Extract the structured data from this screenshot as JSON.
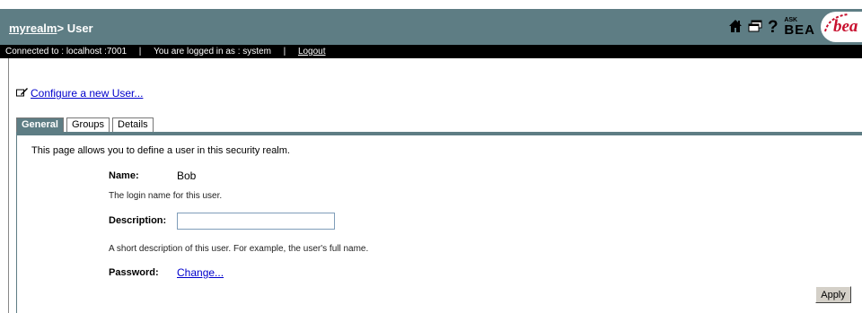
{
  "header": {
    "realm": "myrealm",
    "separator": ">",
    "page": "User",
    "ask_label": "ASK",
    "bea_label": "BEA",
    "logo_text": "bea"
  },
  "status": {
    "connected_label": "Connected to :",
    "host": "localhost :7001",
    "logged_label": "You are logged in as :",
    "user": "system",
    "logout": "Logout"
  },
  "configure_link": "Configure a new User...",
  "tabs": [
    {
      "label": "General",
      "active": true
    },
    {
      "label": "Groups",
      "active": false
    },
    {
      "label": "Details",
      "active": false
    }
  ],
  "form": {
    "intro": "This page allows you to define a user in this security realm.",
    "name_label": "Name:",
    "name_value": "Bob",
    "name_help": "The login name for this user.",
    "description_label": "Description:",
    "description_value": "",
    "description_help": "A short description of this user. For example, the user's full name.",
    "password_label": "Password:",
    "password_link": "Change...",
    "apply_label": "Apply"
  },
  "colors": {
    "header_bg": "#5e7d84",
    "status_bg": "#000000",
    "link": "#0000cc"
  }
}
